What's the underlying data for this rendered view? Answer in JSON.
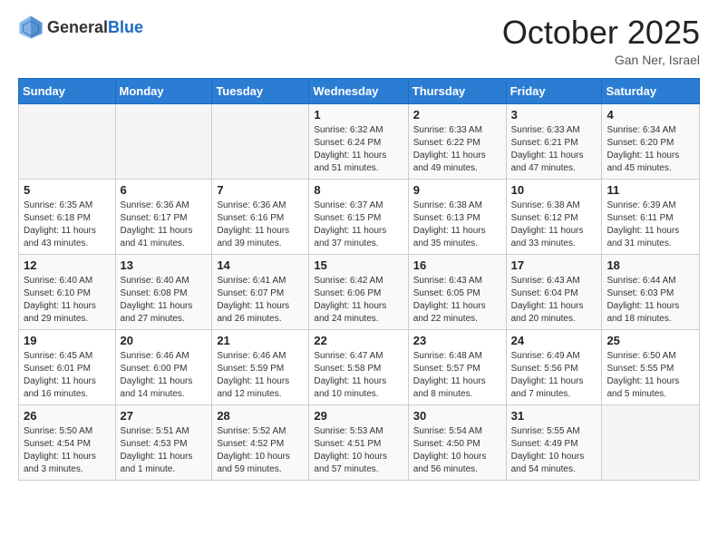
{
  "header": {
    "logo_general": "General",
    "logo_blue": "Blue",
    "month_title": "October 2025",
    "location": "Gan Ner, Israel"
  },
  "days_of_week": [
    "Sunday",
    "Monday",
    "Tuesday",
    "Wednesday",
    "Thursday",
    "Friday",
    "Saturday"
  ],
  "weeks": [
    [
      {
        "day": "",
        "info": ""
      },
      {
        "day": "",
        "info": ""
      },
      {
        "day": "",
        "info": ""
      },
      {
        "day": "1",
        "info": "Sunrise: 6:32 AM\nSunset: 6:24 PM\nDaylight: 11 hours and 51 minutes."
      },
      {
        "day": "2",
        "info": "Sunrise: 6:33 AM\nSunset: 6:22 PM\nDaylight: 11 hours and 49 minutes."
      },
      {
        "day": "3",
        "info": "Sunrise: 6:33 AM\nSunset: 6:21 PM\nDaylight: 11 hours and 47 minutes."
      },
      {
        "day": "4",
        "info": "Sunrise: 6:34 AM\nSunset: 6:20 PM\nDaylight: 11 hours and 45 minutes."
      }
    ],
    [
      {
        "day": "5",
        "info": "Sunrise: 6:35 AM\nSunset: 6:18 PM\nDaylight: 11 hours and 43 minutes."
      },
      {
        "day": "6",
        "info": "Sunrise: 6:36 AM\nSunset: 6:17 PM\nDaylight: 11 hours and 41 minutes."
      },
      {
        "day": "7",
        "info": "Sunrise: 6:36 AM\nSunset: 6:16 PM\nDaylight: 11 hours and 39 minutes."
      },
      {
        "day": "8",
        "info": "Sunrise: 6:37 AM\nSunset: 6:15 PM\nDaylight: 11 hours and 37 minutes."
      },
      {
        "day": "9",
        "info": "Sunrise: 6:38 AM\nSunset: 6:13 PM\nDaylight: 11 hours and 35 minutes."
      },
      {
        "day": "10",
        "info": "Sunrise: 6:38 AM\nSunset: 6:12 PM\nDaylight: 11 hours and 33 minutes."
      },
      {
        "day": "11",
        "info": "Sunrise: 6:39 AM\nSunset: 6:11 PM\nDaylight: 11 hours and 31 minutes."
      }
    ],
    [
      {
        "day": "12",
        "info": "Sunrise: 6:40 AM\nSunset: 6:10 PM\nDaylight: 11 hours and 29 minutes."
      },
      {
        "day": "13",
        "info": "Sunrise: 6:40 AM\nSunset: 6:08 PM\nDaylight: 11 hours and 27 minutes."
      },
      {
        "day": "14",
        "info": "Sunrise: 6:41 AM\nSunset: 6:07 PM\nDaylight: 11 hours and 26 minutes."
      },
      {
        "day": "15",
        "info": "Sunrise: 6:42 AM\nSunset: 6:06 PM\nDaylight: 11 hours and 24 minutes."
      },
      {
        "day": "16",
        "info": "Sunrise: 6:43 AM\nSunset: 6:05 PM\nDaylight: 11 hours and 22 minutes."
      },
      {
        "day": "17",
        "info": "Sunrise: 6:43 AM\nSunset: 6:04 PM\nDaylight: 11 hours and 20 minutes."
      },
      {
        "day": "18",
        "info": "Sunrise: 6:44 AM\nSunset: 6:03 PM\nDaylight: 11 hours and 18 minutes."
      }
    ],
    [
      {
        "day": "19",
        "info": "Sunrise: 6:45 AM\nSunset: 6:01 PM\nDaylight: 11 hours and 16 minutes."
      },
      {
        "day": "20",
        "info": "Sunrise: 6:46 AM\nSunset: 6:00 PM\nDaylight: 11 hours and 14 minutes."
      },
      {
        "day": "21",
        "info": "Sunrise: 6:46 AM\nSunset: 5:59 PM\nDaylight: 11 hours and 12 minutes."
      },
      {
        "day": "22",
        "info": "Sunrise: 6:47 AM\nSunset: 5:58 PM\nDaylight: 11 hours and 10 minutes."
      },
      {
        "day": "23",
        "info": "Sunrise: 6:48 AM\nSunset: 5:57 PM\nDaylight: 11 hours and 8 minutes."
      },
      {
        "day": "24",
        "info": "Sunrise: 6:49 AM\nSunset: 5:56 PM\nDaylight: 11 hours and 7 minutes."
      },
      {
        "day": "25",
        "info": "Sunrise: 6:50 AM\nSunset: 5:55 PM\nDaylight: 11 hours and 5 minutes."
      }
    ],
    [
      {
        "day": "26",
        "info": "Sunrise: 5:50 AM\nSunset: 4:54 PM\nDaylight: 11 hours and 3 minutes."
      },
      {
        "day": "27",
        "info": "Sunrise: 5:51 AM\nSunset: 4:53 PM\nDaylight: 11 hours and 1 minute."
      },
      {
        "day": "28",
        "info": "Sunrise: 5:52 AM\nSunset: 4:52 PM\nDaylight: 10 hours and 59 minutes."
      },
      {
        "day": "29",
        "info": "Sunrise: 5:53 AM\nSunset: 4:51 PM\nDaylight: 10 hours and 57 minutes."
      },
      {
        "day": "30",
        "info": "Sunrise: 5:54 AM\nSunset: 4:50 PM\nDaylight: 10 hours and 56 minutes."
      },
      {
        "day": "31",
        "info": "Sunrise: 5:55 AM\nSunset: 4:49 PM\nDaylight: 10 hours and 54 minutes."
      },
      {
        "day": "",
        "info": ""
      }
    ]
  ]
}
